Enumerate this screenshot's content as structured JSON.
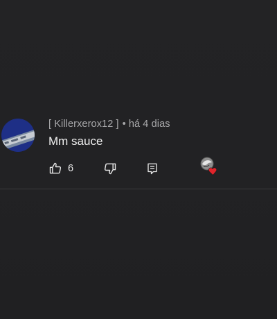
{
  "comment": {
    "author": "[ Killerxerox12 ]",
    "separator": "•",
    "time_ago": "há 4 dias",
    "text": "Mm sauce",
    "likes": "6"
  },
  "icons": {
    "like": "thumbs-up-icon",
    "dislike": "thumbs-down-icon",
    "reply": "reply-comment-icon",
    "heart": "creator-heart-badge"
  },
  "colors": {
    "background": "#222224",
    "meta_text": "#a9a9ab",
    "body_text": "#f1f1f1",
    "heart": "#e0242b"
  }
}
